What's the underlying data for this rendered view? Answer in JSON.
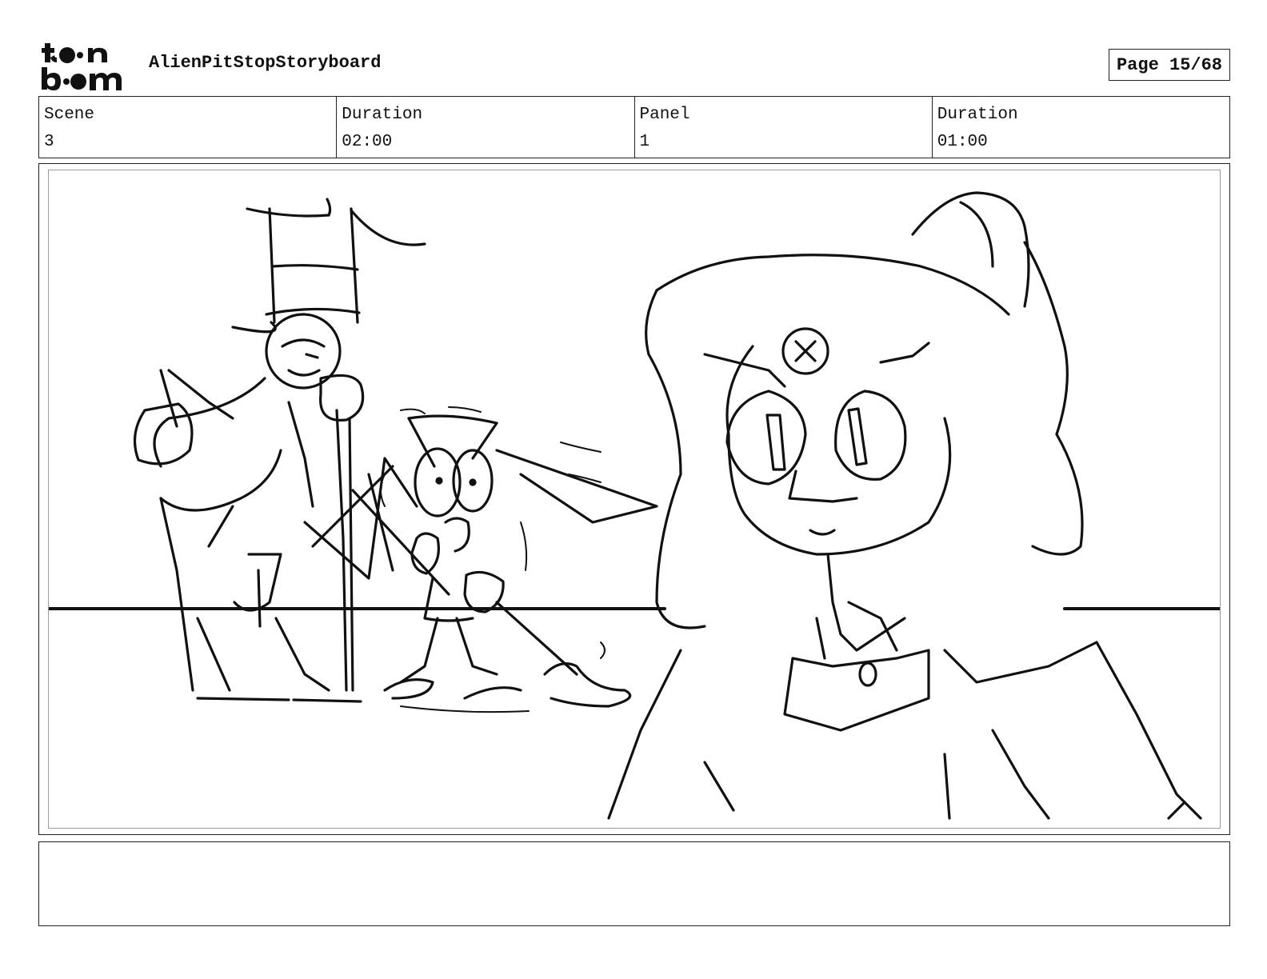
{
  "header": {
    "logo_text": "toon boom",
    "project_title": "AlienPitStopStoryboard",
    "page_indicator": "Page 15/68"
  },
  "info": {
    "scene_label": "Scene",
    "scene_value": "3",
    "scene_duration_label": "Duration",
    "scene_duration_value": "02:00",
    "panel_label": "Panel",
    "panel_value": "1",
    "panel_duration_label": "Duration",
    "panel_duration_value": "01:00"
  },
  "panel": {
    "drawing_icon": "storyboard-sketch"
  },
  "notes": {
    "text": ""
  }
}
